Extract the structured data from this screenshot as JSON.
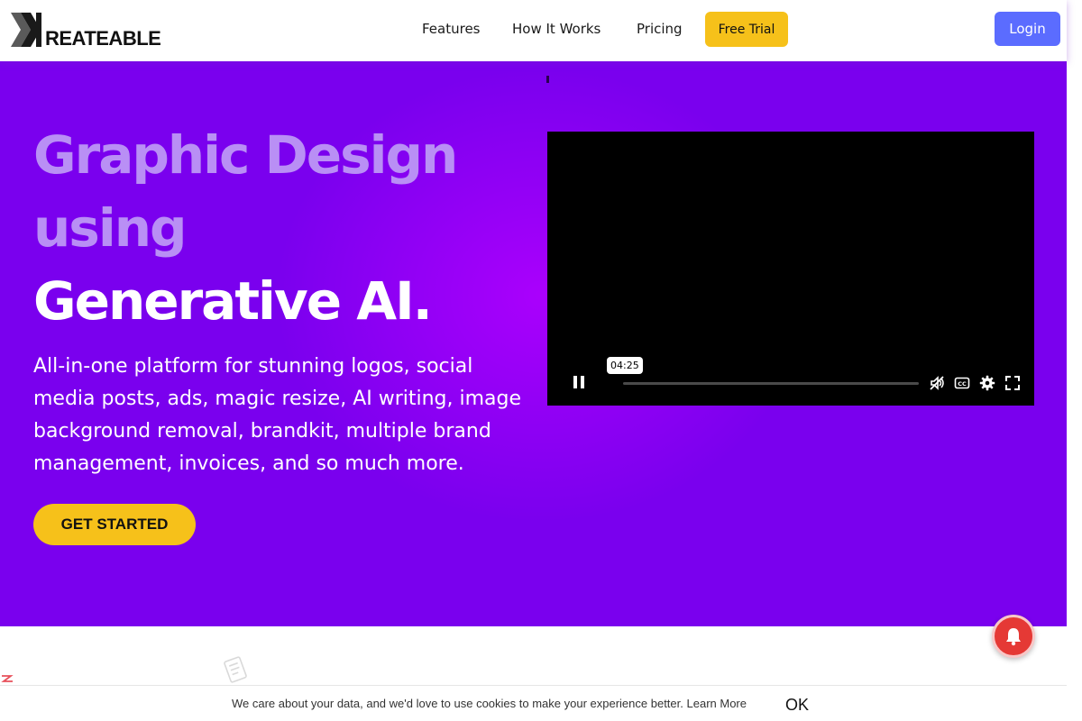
{
  "header": {
    "logo_text": "REATEABLE",
    "nav": [
      "Features",
      "How It Works",
      "Pricing"
    ],
    "free_trial_label": "Free Trial",
    "login_label": "Login"
  },
  "hero": {
    "title_line1": "Graphic Design",
    "title_line2": "using",
    "title_line3": "Generative AI.",
    "description": "All-in-one platform for stunning logos, social media posts, ads, magic resize, AI writing, image background removal, brandkit, multiple brand management, invoices, and so much more.",
    "cta_label": "GET STARTED"
  },
  "video": {
    "time_tooltip": "04:25",
    "controls": [
      "pause-icon",
      "no-audio-icon",
      "captions-icon",
      "settings-icon",
      "fullscreen-icon"
    ]
  },
  "cookie": {
    "message": "We care about your data, and we'd love to use cookies to make your experience better.",
    "learn_more": "Learn More",
    "ok_label": "OK"
  },
  "colors": {
    "hero_purple": "#7a00ee",
    "hero_glow": "#b200ff",
    "accent_yellow": "#f6c11a",
    "login_blue": "#5b6cff",
    "title_faded": "#b98ff5",
    "notification_red": "#e53935"
  }
}
